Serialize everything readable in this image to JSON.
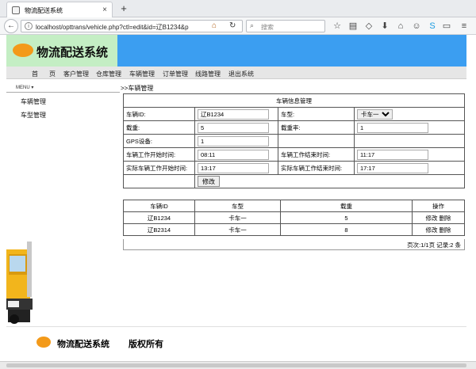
{
  "browser": {
    "tab_title": "物流配送系统",
    "tab_close": "×",
    "new_tab": "+",
    "url": "localhost/opttrans/vehicle.php?ctl=edit&id=辽B1234&p",
    "search_placeholder": "搜索"
  },
  "app": {
    "logo_text": "物流配送系统",
    "menu": [
      "首",
      "页",
      "客户管理",
      "仓库管理",
      "车辆管理",
      "订单管理",
      "线路管理",
      "退出系统"
    ],
    "side_menu_label": "MENU ▾",
    "side_items": [
      "车辆管理",
      "车型管理"
    ],
    "breadcrumb": ">>车辆管理"
  },
  "form": {
    "title": "车辆信息管理",
    "vehicle_id_label": "车辆ID:",
    "vehicle_id": "辽B1234",
    "type_label": "车型:",
    "type_value": "卡车一",
    "load_label": "载重:",
    "load_value": "5",
    "load_rate_label": "载重率:",
    "load_rate_value": "1",
    "gps_label": "GPS设备:",
    "gps_value": "1",
    "start_label": "车辆工作开始时间:",
    "start_value": "08:11",
    "end_label": "车辆工作结束时间:",
    "end_value": "11:17",
    "actual_start_label": "实际车辆工作开始时间:",
    "actual_start_value": "13:17",
    "actual_end_label": "实际车辆工作结束时间:",
    "actual_end_value": "17:17",
    "submit": "修改"
  },
  "list": {
    "headers": [
      "车辆ID",
      "车型",
      "载重",
      "操作"
    ],
    "rows": [
      {
        "id": "辽B1234",
        "type": "卡车一",
        "load": "5",
        "edit": "修改",
        "del": "删除"
      },
      {
        "id": "辽B2314",
        "type": "卡车一",
        "load": "8",
        "edit": "修改",
        "del": "删除"
      }
    ],
    "pager": "页次:1/1页 记录:2 条"
  },
  "footer": {
    "name": "物流配送系统",
    "copyright": "版权所有"
  }
}
